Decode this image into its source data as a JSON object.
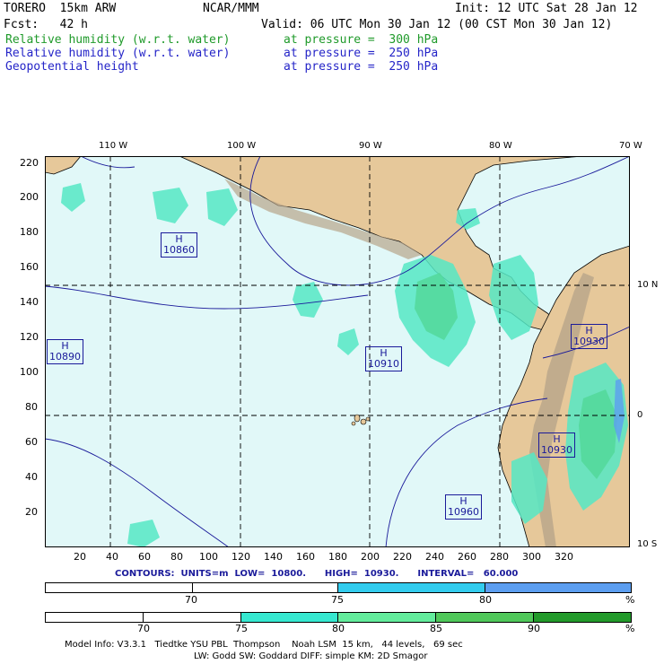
{
  "header": {
    "model": "TORERO  15km ARW",
    "center": "NCAR/MMM",
    "init": "Init: 12 UTC Sat 28 Jan 12",
    "fcst": "Fcst:   42 h",
    "valid": "Valid: 06 UTC Mon 30 Jan 12 (00 CST Mon 30 Jan 12)",
    "fields": [
      {
        "name": "Relative humidity (w.r.t. water)",
        "level": "at pressure =  300 hPa",
        "color": "#1f9a2a"
      },
      {
        "name": "Relative humidity (w.r.t. water)",
        "level": "at pressure =  250 hPa",
        "color": "#2525c8"
      },
      {
        "name": "Geopotential height",
        "level": "at pressure =  250 hPa",
        "color": "#2525c8"
      }
    ]
  },
  "map": {
    "lon_labels": [
      "110 W",
      "100 W",
      "90 W",
      "80 W",
      "70 W"
    ],
    "lat_labels": [
      "10 N",
      "0",
      "10 S"
    ],
    "y_ticks": [
      "220",
      "200",
      "180",
      "160",
      "140",
      "120",
      "100",
      "80",
      "60",
      "40",
      "20"
    ],
    "x_ticks": [
      "20",
      "40",
      "60",
      "80",
      "100",
      "120",
      "140",
      "160",
      "180",
      "200",
      "220",
      "240",
      "260",
      "280",
      "300",
      "320"
    ],
    "highs": [
      {
        "letter": "H",
        "value": "10860"
      },
      {
        "letter": "H",
        "value": "10890"
      },
      {
        "letter": "H",
        "value": "10910"
      },
      {
        "letter": "H",
        "value": "10930"
      },
      {
        "letter": "H",
        "value": "10930"
      },
      {
        "letter": "H",
        "value": "10960"
      }
    ],
    "colors": {
      "ocean": "#e1f8f8",
      "land": "#e6c89a",
      "terrain": "#b8a58a",
      "rh_light": "#55e8c4",
      "rh_mid": "#52d89a",
      "rh_dark": "#3cb860",
      "contour": "#1a1a9a"
    }
  },
  "contours_line": "CONTOURS:  UNITS=m  LOW=  10800.      HIGH=  10930.      INTERVAL=   60.000",
  "colorbar1": {
    "labels": [
      "70",
      "75",
      "80",
      "%"
    ],
    "colors": [
      "#ffffff",
      "#ffffff",
      "#33ccee",
      "#5c9ef0"
    ]
  },
  "colorbar2": {
    "labels": [
      "70",
      "75",
      "80",
      "85",
      "90",
      "%"
    ],
    "colors": [
      "#ffffff",
      "#ffffff",
      "#36e8d0",
      "#63ec9c",
      "#50c85a",
      "#229a2a"
    ]
  },
  "footer": {
    "line1": "Model Info: V3.3.1   Tiedtke YSU PBL  Thompson    Noah LSM  15 km,   44 levels,   69 sec",
    "line2": "LW: Godd SW: Goddard DIFF: simple KM: 2D Smagor"
  }
}
